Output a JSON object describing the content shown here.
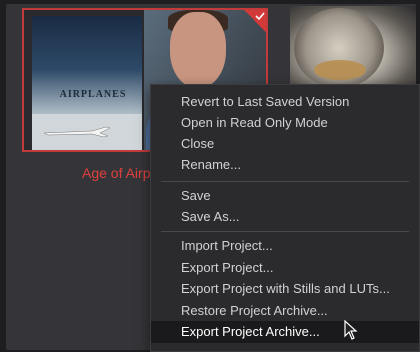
{
  "project": {
    "name_visible": "Age of Airp",
    "poster_title": "AIRPLANES"
  },
  "menu": {
    "groups": [
      {
        "items": [
          {
            "label": "Revert to Last Saved Version"
          },
          {
            "label": "Open in Read Only Mode"
          },
          {
            "label": "Close"
          },
          {
            "label": "Rename..."
          }
        ]
      },
      {
        "items": [
          {
            "label": "Save"
          },
          {
            "label": "Save As..."
          }
        ]
      },
      {
        "items": [
          {
            "label": "Import Project..."
          },
          {
            "label": "Export Project..."
          },
          {
            "label": "Export Project with Stills and LUTs..."
          },
          {
            "label": "Restore Project Archive..."
          },
          {
            "label": "Export Project Archive...",
            "highlighted": true
          }
        ]
      }
    ]
  },
  "colors": {
    "selected_border": "#c23a3a",
    "project_name": "#e0403c",
    "menu_bg": "#2b2b2e",
    "panel_bg": "#353539"
  }
}
